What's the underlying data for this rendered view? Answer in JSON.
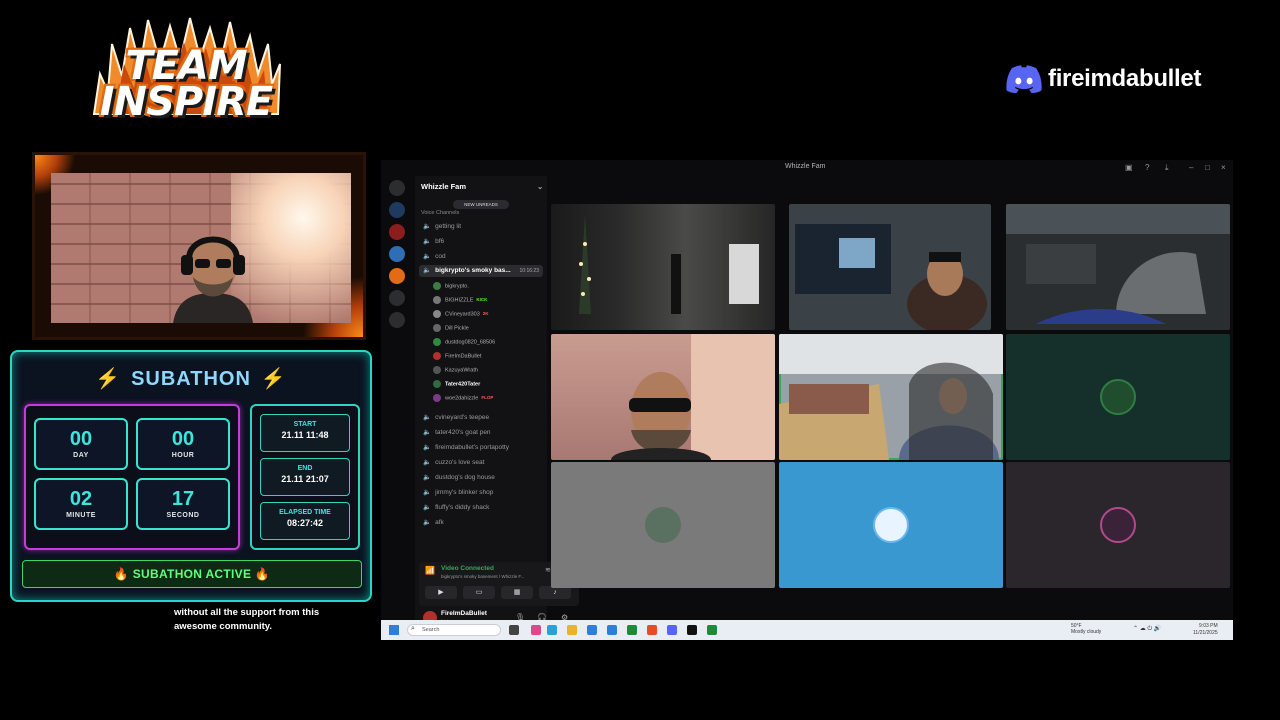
{
  "team_logo": {
    "line1": "TEAM",
    "line2": "INSPIRE"
  },
  "brand": {
    "name": "fireimdabullet",
    "icon": "discord-icon"
  },
  "subathon": {
    "title": "SUBATHON",
    "timer": [
      {
        "value": "00",
        "label": "DAY"
      },
      {
        "value": "00",
        "label": "HOUR"
      },
      {
        "value": "02",
        "label": "MINUTE"
      },
      {
        "value": "17",
        "label": "SECOND"
      }
    ],
    "start_label": "START",
    "start_value": "21.11 11:48",
    "end_label": "END",
    "end_value": "21.11 21:07",
    "elapsed_label": "ELAPSED TIME",
    "elapsed_value": "08:27:42",
    "status": "SUBATHON ACTIVE",
    "colors": {
      "accent": "#3be7dd",
      "border": "#28d8c4",
      "clock_border": "#c63bd9",
      "status": "#5fff80"
    }
  },
  "caption": "without all the support from this awesome community.",
  "discord": {
    "window_title": "Whizzle Fam",
    "server_name": "Whizzle Fam",
    "new_unreads": "NEW UNREADS",
    "voice_channels_label": "Voice Channels",
    "channels_top": [
      "getting lit",
      "bf6",
      "cod"
    ],
    "active_channel": {
      "name": "bigkrypto's smoky bas...",
      "time": "10:16:23"
    },
    "members": [
      {
        "name": "bigkrypto.",
        "tag": "",
        "tag_color": ""
      },
      {
        "name": "BIGHIZZLE",
        "tag": "KICK",
        "tag_color": "#53fc18"
      },
      {
        "name": "CVineyard303",
        "tag": "2K",
        "tag_color": "#ff5a5a"
      },
      {
        "name": "Dill Pickle",
        "tag": "",
        "tag_color": ""
      },
      {
        "name": "dustdog0820_68506",
        "tag": "",
        "tag_color": ""
      },
      {
        "name": "FireImDaBullet",
        "tag": "",
        "tag_color": ""
      },
      {
        "name": "KazuyaWrath",
        "tag": "",
        "tag_color": ""
      },
      {
        "name": "Tater420Tater",
        "tag": "",
        "tag_color": ""
      },
      {
        "name": "woe2dahizzle",
        "tag": "FLOP",
        "tag_color": "#ff5a5a"
      }
    ],
    "channels_bottom": [
      "cvineyard's teepee",
      "tater420's goat pen",
      "fireimdabullet's portapotty",
      "cuzzo's love seat",
      "dustdog's dog house",
      "jimmy's blinker shop",
      "fluffy's diddy shack",
      "afk"
    ],
    "voice_status": "Video Connected",
    "voice_sub": "bigkrypto's smoky basement / Whizzle F...",
    "user": {
      "name": "FireImDaBullet",
      "status": "high"
    }
  },
  "taskbar": {
    "search_placeholder": "Search",
    "weather_temp": "50°F",
    "weather_desc": "Mostly cloudy",
    "time": "9:03 PM",
    "date": "11/21/2025"
  }
}
